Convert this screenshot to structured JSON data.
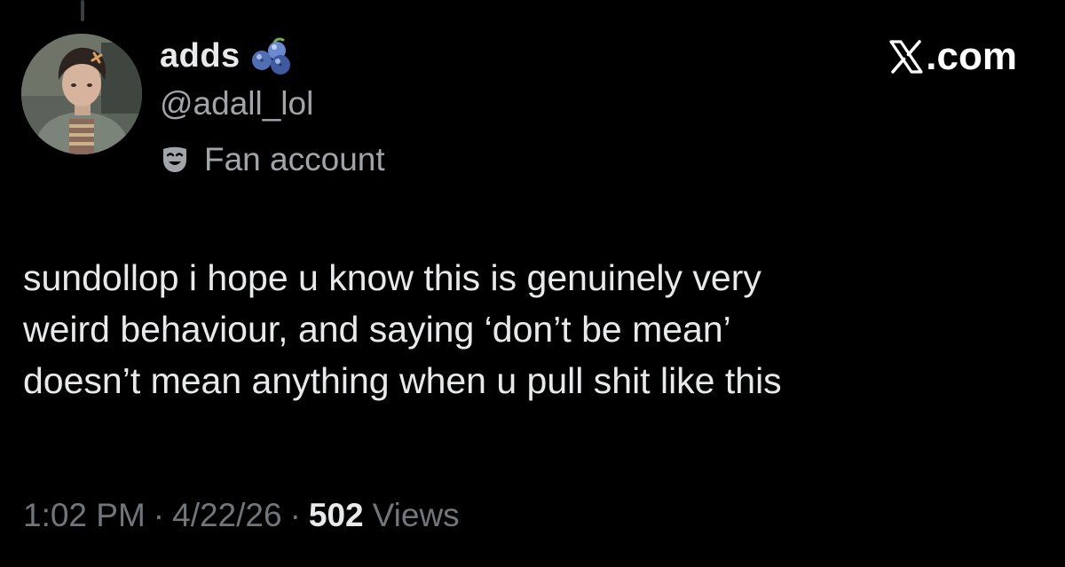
{
  "profile": {
    "display_name": "adds",
    "handle": "@adall_lol",
    "account_label": "Fan account",
    "name_emoji_icon": "blueberries-icon",
    "label_icon": "theater-mask-icon",
    "avatar_icon": "profile-photo"
  },
  "brand": {
    "logo_icon": "x-logo-icon",
    "domain": ".com",
    "color": "#ffffff"
  },
  "tweet": {
    "lines": [
      "sundollop i hope u know this is genuinely very",
      "weird behaviour, and saying ‘don’t be mean’",
      "doesn’t mean anything when u pull shit like this"
    ]
  },
  "meta": {
    "time": "1:02 PM",
    "separator": "·",
    "date": "4/22/26",
    "views_count": "502",
    "views_label": "Views"
  },
  "colors": {
    "background": "#000000",
    "primary_text": "#e7e9ea",
    "secondary_text": "#a1a5a9",
    "meta_text": "#71767b"
  }
}
